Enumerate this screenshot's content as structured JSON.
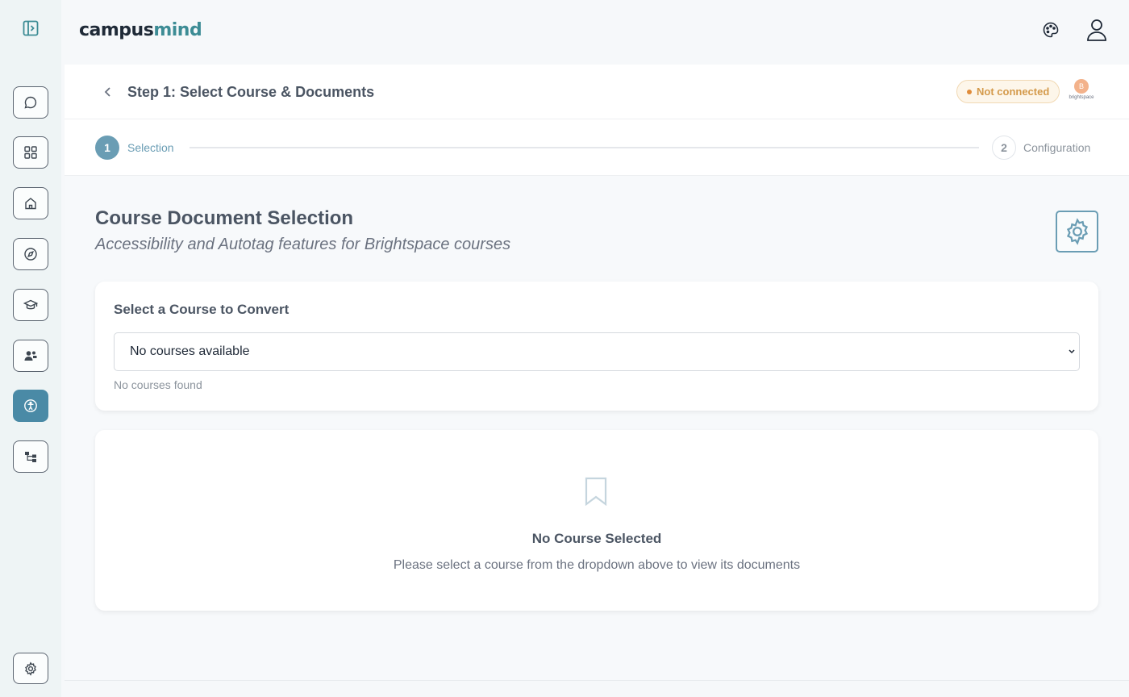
{
  "app": {
    "logo_part1": "campus",
    "logo_part2": "mind"
  },
  "sidebar": {
    "items": [
      {
        "icon": "chat-icon"
      },
      {
        "icon": "apps-grid-icon"
      },
      {
        "icon": "home-icon"
      },
      {
        "icon": "compass-icon"
      },
      {
        "icon": "graduation-cap-icon"
      },
      {
        "icon": "users-icon"
      },
      {
        "icon": "accessibility-icon",
        "active": true
      },
      {
        "icon": "workflow-icon"
      }
    ],
    "settings_icon": "gear-icon"
  },
  "header": {
    "step_title": "Step 1: Select Course & Documents",
    "status_badge": "Not connected",
    "integration_logo_text": "brightspace"
  },
  "stepper": {
    "steps": [
      {
        "number": "1",
        "label": "Selection",
        "state": "active"
      },
      {
        "number": "2",
        "label": "Configuration",
        "state": "pending"
      }
    ]
  },
  "page": {
    "title": "Course Document Selection",
    "subtitle": "Accessibility and Autotag features for Brightspace courses"
  },
  "course_select": {
    "title": "Select a Course to Convert",
    "selected_value": "No courses available",
    "help_text": "No courses found"
  },
  "empty_state": {
    "title": "No Course Selected",
    "message": "Please select a course from the dropdown above to view its documents"
  },
  "colors": {
    "accent": "#6a9db4",
    "active_rail": "#4a8aa6",
    "brand_teal": "#3d8c95",
    "warning": "#e08c3a"
  }
}
